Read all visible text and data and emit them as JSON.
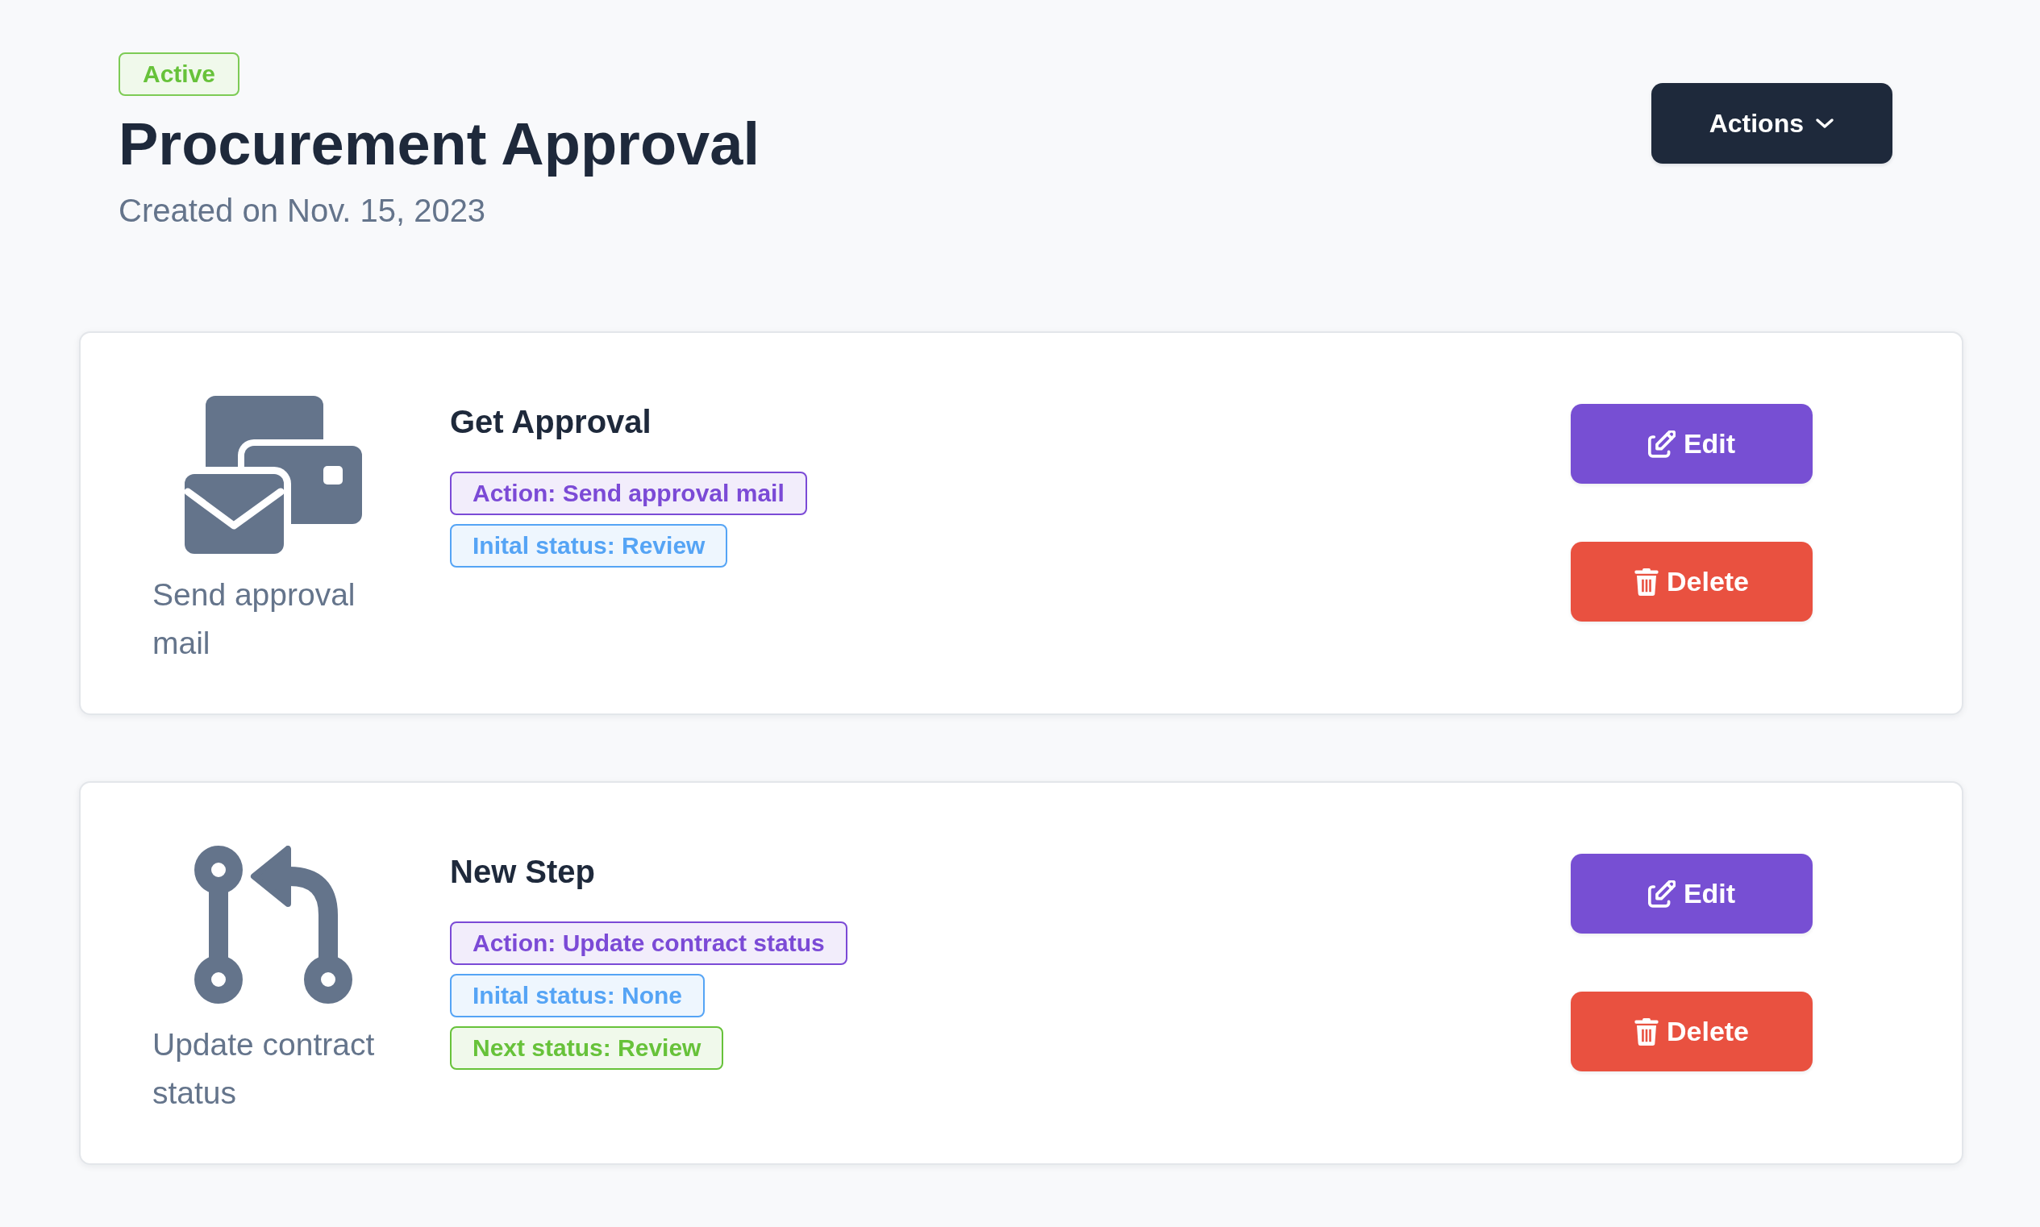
{
  "header": {
    "status_badge": "Active",
    "title": "Procurement Approval",
    "subtitle": "Created on Nov. 15, 2023",
    "actions_button": "Actions"
  },
  "steps": [
    {
      "kind": "mail",
      "icon_label": "Send approval mail",
      "title": "Get Approval",
      "tags": [
        {
          "text": "Action: Send approval mail",
          "color": "#7b4ad6"
        },
        {
          "text": "Inital status: Review",
          "color": "#55a4f5"
        }
      ],
      "buttons": [
        {
          "kind": "edit",
          "label": "Edit"
        },
        {
          "kind": "delete",
          "label": "Delete"
        }
      ]
    },
    {
      "kind": "status",
      "icon_label": "Update contract status",
      "title": "New Step",
      "tags": [
        {
          "text": "Action: Update contract status",
          "color": "#7b4ad6"
        },
        {
          "text": "Inital status: None",
          "color": "#55a4f5"
        },
        {
          "text": "Next status: Review",
          "color": "#67c23a"
        }
      ],
      "buttons": [
        {
          "kind": "edit",
          "label": "Edit"
        },
        {
          "kind": "delete",
          "label": "Delete"
        }
      ]
    }
  ]
}
